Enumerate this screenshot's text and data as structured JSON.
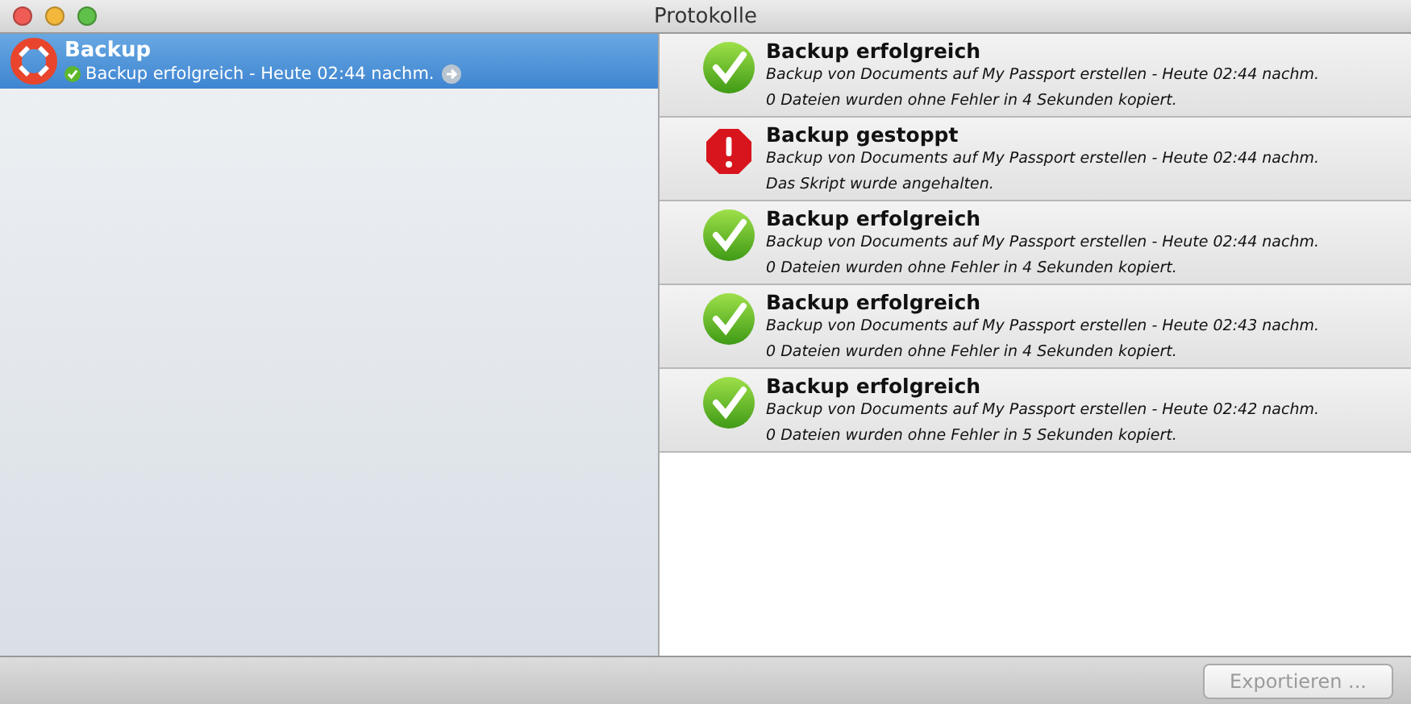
{
  "window": {
    "title": "Protokolle"
  },
  "sidebar": {
    "items": [
      {
        "title": "Backup",
        "status": "Backup erfolgreich - Heute 02:44 nachm.",
        "kind": "success",
        "selected": true
      }
    ]
  },
  "log": [
    {
      "kind": "success",
      "title": "Backup erfolgreich",
      "line1": "Backup von Documents auf My Passport erstellen - Heute 02:44 nachm.",
      "line2": "0 Dateien wurden ohne Fehler in 4 Sekunden kopiert."
    },
    {
      "kind": "error",
      "title": "Backup gestoppt",
      "line1": "Backup von Documents auf My Passport erstellen - Heute 02:44 nachm.",
      "line2": "Das Skript wurde angehalten."
    },
    {
      "kind": "success",
      "title": "Backup erfolgreich",
      "line1": "Backup von Documents auf My Passport erstellen - Heute 02:44 nachm.",
      "line2": "0 Dateien wurden ohne Fehler in 4 Sekunden kopiert."
    },
    {
      "kind": "success",
      "title": "Backup erfolgreich",
      "line1": "Backup von Documents auf My Passport erstellen - Heute 02:43 nachm.",
      "line2": "0 Dateien wurden ohne Fehler in 4 Sekunden kopiert."
    },
    {
      "kind": "success",
      "title": "Backup erfolgreich",
      "line1": "Backup von Documents auf My Passport erstellen - Heute 02:42 nachm.",
      "line2": "0 Dateien wurden ohne Fehler in 5 Sekunden kopiert."
    }
  ],
  "export_button": {
    "label": "Exportieren ...",
    "disabled": true
  }
}
